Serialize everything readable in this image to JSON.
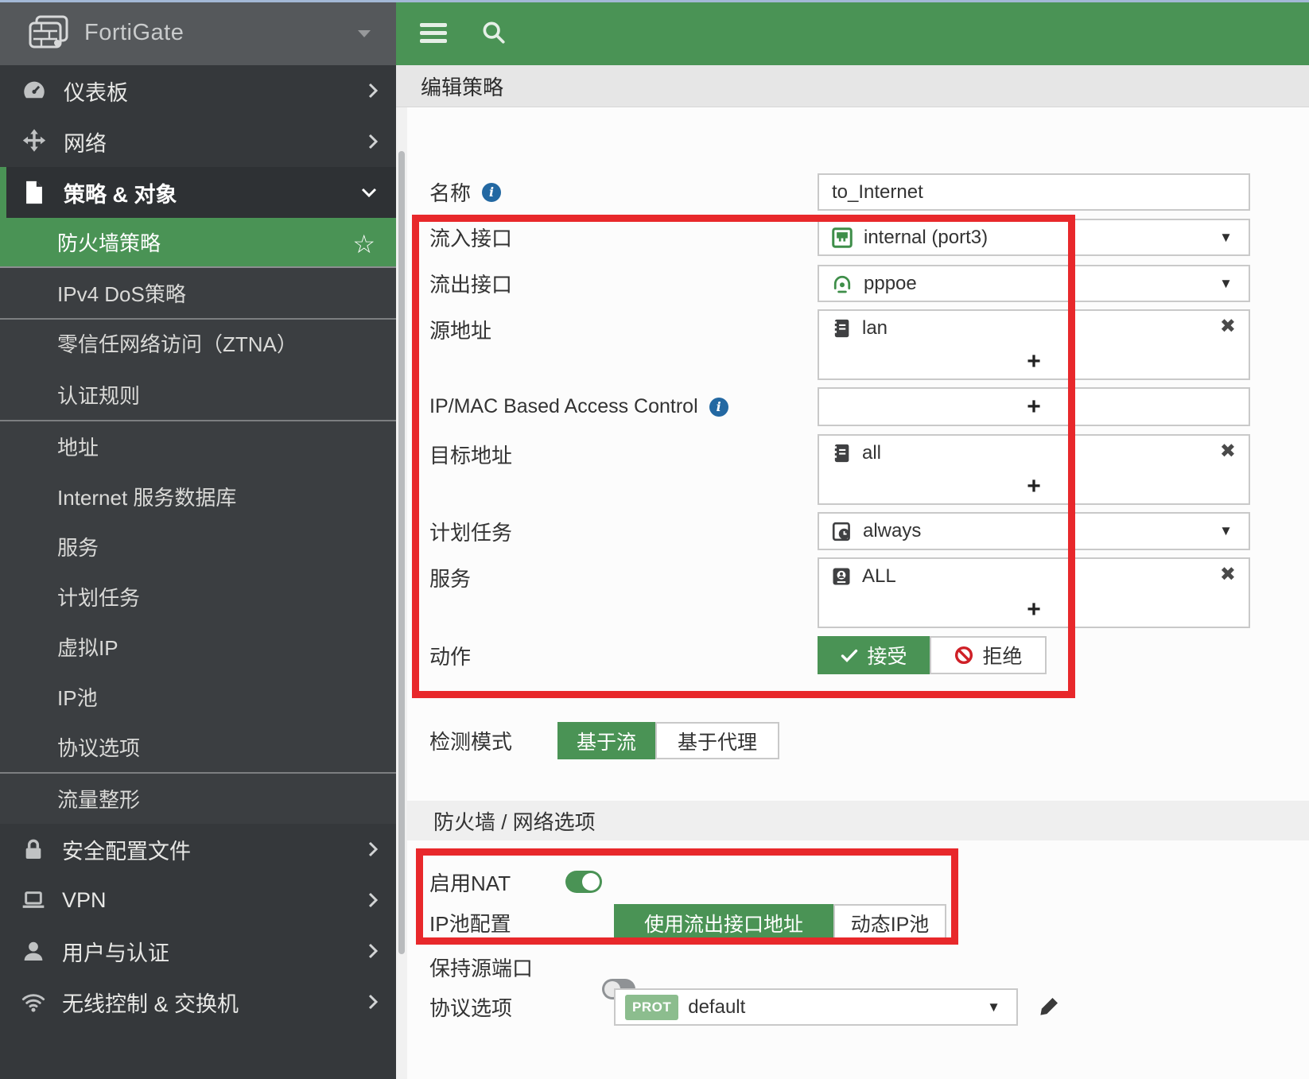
{
  "brand": {
    "name": "FortiGate",
    "logo_icon": "fortigate-firewall-icon"
  },
  "page": {
    "title": "编辑策略"
  },
  "topbar": {
    "menu_icon": "hamburger-menu-icon",
    "search_icon": "search-icon"
  },
  "sidebar": {
    "top_items": [
      {
        "label": "仪表板",
        "icon": "gauge-icon"
      },
      {
        "label": "网络",
        "icon": "move-arrows-icon"
      },
      {
        "label": "策略 & 对象",
        "icon": "policy-document-icon",
        "expanded": true
      }
    ],
    "sub_items": [
      {
        "label": "防火墙策略",
        "selected": true,
        "star_icon": "star-icon"
      },
      {
        "label": "IPv4 DoS策略"
      },
      {
        "label": "零信任网络访问（ZTNA）"
      },
      {
        "label": "认证规则"
      },
      {
        "label": "地址"
      },
      {
        "label": "Internet 服务数据库"
      },
      {
        "label": "服务"
      },
      {
        "label": "计划任务"
      },
      {
        "label": "虚拟IP"
      },
      {
        "label": "IP池"
      },
      {
        "label": "协议选项"
      },
      {
        "label": "流量整形"
      }
    ],
    "bottom_items": [
      {
        "label": "安全配置文件",
        "icon": "lock-icon"
      },
      {
        "label": "VPN",
        "icon": "laptop-icon"
      },
      {
        "label": "用户与认证",
        "icon": "user-icon"
      },
      {
        "label": "无线控制 & 交换机",
        "icon": "wifi-icon"
      }
    ]
  },
  "form": {
    "name": {
      "label": "名称",
      "value": "to_Internet"
    },
    "incoming": {
      "label": "流入接口",
      "value": "internal (port3)",
      "icon": "ethernet-port-icon"
    },
    "outgoing": {
      "label": "流出接口",
      "value": "pppoe",
      "icon": "pppoe-user-icon"
    },
    "source": {
      "label": "源地址",
      "value": "lan",
      "icon": "address-book-icon"
    },
    "ipmac": {
      "label": "IP/MAC Based Access Control"
    },
    "destination": {
      "label": "目标地址",
      "value": "all",
      "icon": "address-book-icon"
    },
    "schedule": {
      "label": "计划任务",
      "value": "always",
      "icon": "schedule-clock-icon"
    },
    "service": {
      "label": "服务",
      "value": "ALL",
      "icon": "service-icon"
    },
    "action": {
      "label": "动作",
      "accept": "接受",
      "deny": "拒绝"
    },
    "inspection": {
      "label": "检测模式",
      "flow": "基于流",
      "proxy": "基于代理"
    }
  },
  "network_section": {
    "title": "防火墙 / 网络选项",
    "nat": {
      "label": "启用NAT",
      "enabled": true
    },
    "ippool": {
      "label": "IP池配置",
      "option_selected": "使用流出接口地址",
      "option_other": "动态IP池"
    },
    "preserve_port": {
      "label": "保持源端口",
      "enabled": false
    },
    "protocol": {
      "label": "协议选项",
      "badge": "PROT",
      "value": "default",
      "edit_icon": "pencil-icon"
    }
  },
  "colors": {
    "accent_green": "#4a9355",
    "annotation_red": "#e8282b",
    "info_blue": "#2368a2",
    "sidebar_dark": "#35383b",
    "submenu_dark": "#3b3e41"
  }
}
